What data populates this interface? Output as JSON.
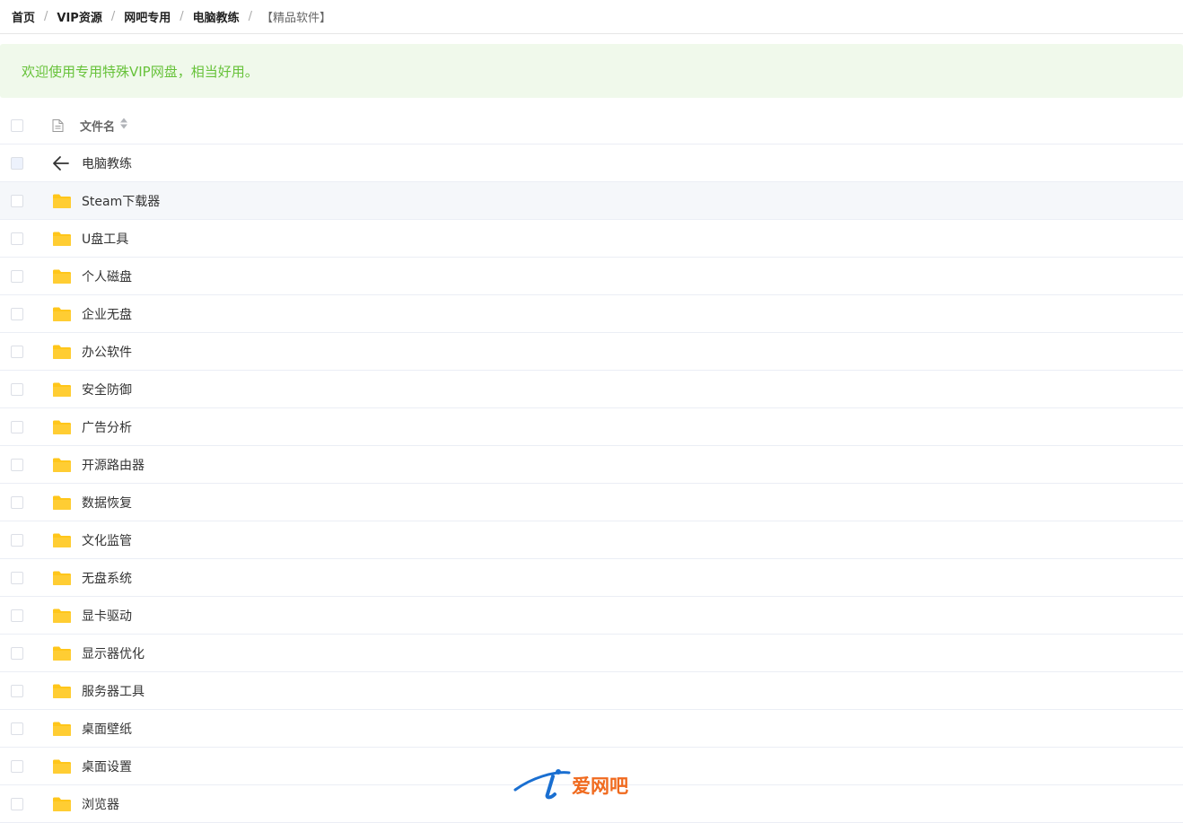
{
  "breadcrumb": {
    "items": [
      "首页",
      "VIP资源",
      "网吧专用",
      "电脑教练"
    ],
    "current": "【精品软件】",
    "separator": "/"
  },
  "alert": {
    "text": "欢迎使用专用特殊VIP网盘，相当好用。"
  },
  "table": {
    "header": {
      "name_label": "文件名"
    },
    "back_row": {
      "label": "电脑教练",
      "icon": "arrow-left-icon"
    },
    "folders": [
      "Steam下载器",
      "U盘工具",
      "个人磁盘",
      "企业无盘",
      "办公软件",
      "安全防御",
      "广告分析",
      "开源路由器",
      "数据恢复",
      "文化监管",
      "无盘系统",
      "显卡驱动",
      "显示器优化",
      "服务器工具",
      "桌面壁纸",
      "桌面设置",
      "浏览器"
    ]
  },
  "watermark": {
    "text": "爱网吧"
  },
  "colors": {
    "folder": "#ffc61a",
    "alert_bg": "#f0f9eb",
    "alert_text": "#67c23a",
    "watermark_blue": "#1a6fd1",
    "watermark_orange": "#f06a1e"
  }
}
